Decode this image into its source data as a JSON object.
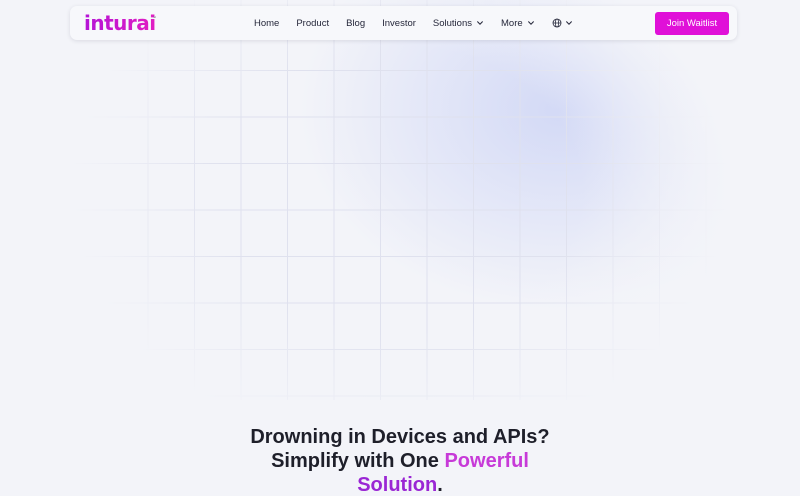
{
  "brand": {
    "logo_text": "inturai",
    "tm": "™",
    "accent_color": "#e010d8"
  },
  "nav": {
    "items": [
      {
        "label": "Home",
        "has_dropdown": false
      },
      {
        "label": "Product",
        "has_dropdown": false
      },
      {
        "label": "Blog",
        "has_dropdown": false
      },
      {
        "label": "Investor",
        "has_dropdown": false
      },
      {
        "label": "Solutions",
        "has_dropdown": true
      },
      {
        "label": "More",
        "has_dropdown": true
      }
    ],
    "language_icon": "globe-icon",
    "cta_label": "Join Waitlist"
  },
  "hero": {
    "line1": "Drowning in Devices and APIs?",
    "line2_prefix": "Simplify with One ",
    "line2_accent": "Powerful",
    "line3_accent": "Solution",
    "line3_suffix": "."
  }
}
